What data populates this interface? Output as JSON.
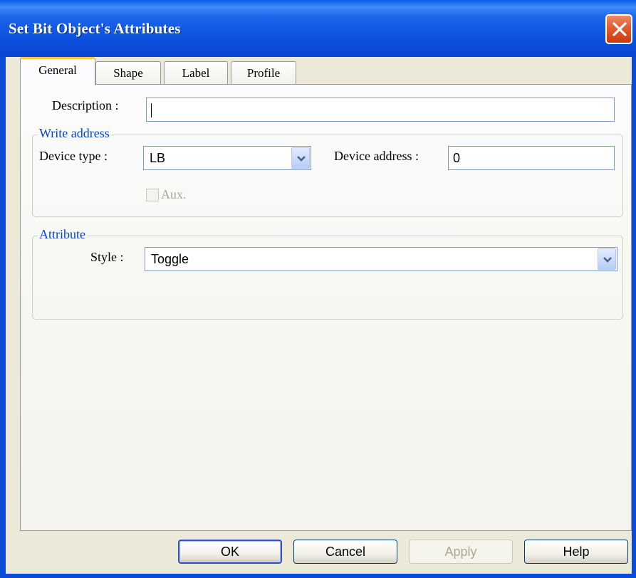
{
  "window": {
    "title": "Set Bit Object's Attributes"
  },
  "tabs": [
    {
      "label": "General"
    },
    {
      "label": "Shape"
    },
    {
      "label": "Label"
    },
    {
      "label": "Profile"
    }
  ],
  "general": {
    "description_label": "Description :",
    "description_value": "",
    "write_address": {
      "legend": "Write address",
      "device_type_label": "Device type :",
      "device_type_value": "LB",
      "device_address_label": "Device address :",
      "device_address_value": "0",
      "aux_label": "Aux."
    },
    "attribute": {
      "legend": "Attribute",
      "style_label": "Style :",
      "style_value": "Toggle"
    }
  },
  "buttons": {
    "ok": "OK",
    "cancel": "Cancel",
    "apply": "Apply",
    "help": "Help"
  },
  "colors": {
    "titlebar": "#0a50dd",
    "legend_text": "#0046d5",
    "active_tab_accent": "#ffc83c"
  }
}
